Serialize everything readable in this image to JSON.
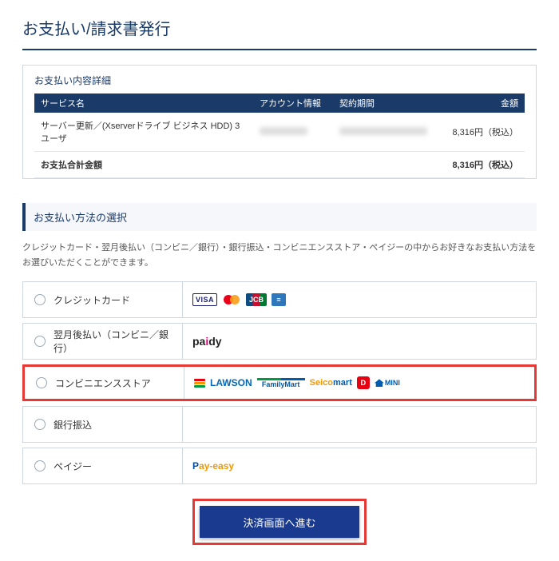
{
  "page": {
    "title": "お支払い/請求書発行"
  },
  "detail": {
    "title": "お支払い内容詳細",
    "headers": {
      "service": "サービス名",
      "account": "アカウント情報",
      "period": "契約期間",
      "amount": "金額"
    },
    "row": {
      "service": "サーバー更新／(Xserverドライブ ビジネス HDD) 3ユーザ",
      "amount": "8,316円（税込）"
    },
    "total": {
      "label": "お支払合計金額",
      "amount": "8,316円（税込）"
    }
  },
  "method": {
    "heading": "お支払い方法の選択",
    "help": "クレジットカード・翌月後払い（コンビニ／銀行）・銀行振込・コンビニエンスストア・ペイジーの中からお好きなお支払い方法をお選びいただくことができます。",
    "options": {
      "credit": "クレジットカード",
      "paidy": "翌月後払い（コンビニ／銀行）",
      "cvs": "コンビニエンスストア",
      "bank": "銀行振込",
      "payeasy": "ペイジー"
    }
  },
  "brand": {
    "visa": "VISA",
    "jcb": "JCB",
    "paidy_pa": "pa",
    "paidy_i": "i",
    "paidy_dy": "dy",
    "lawson": "LAWSON",
    "famima": "FamilyMart",
    "seico_s": "Seico",
    "seico_m": "mart",
    "daily": "D",
    "mini": "MINI",
    "payeasy_p": "P",
    "payeasy_e": "ay-easy"
  },
  "submit": {
    "label": "決済画面へ進む"
  }
}
